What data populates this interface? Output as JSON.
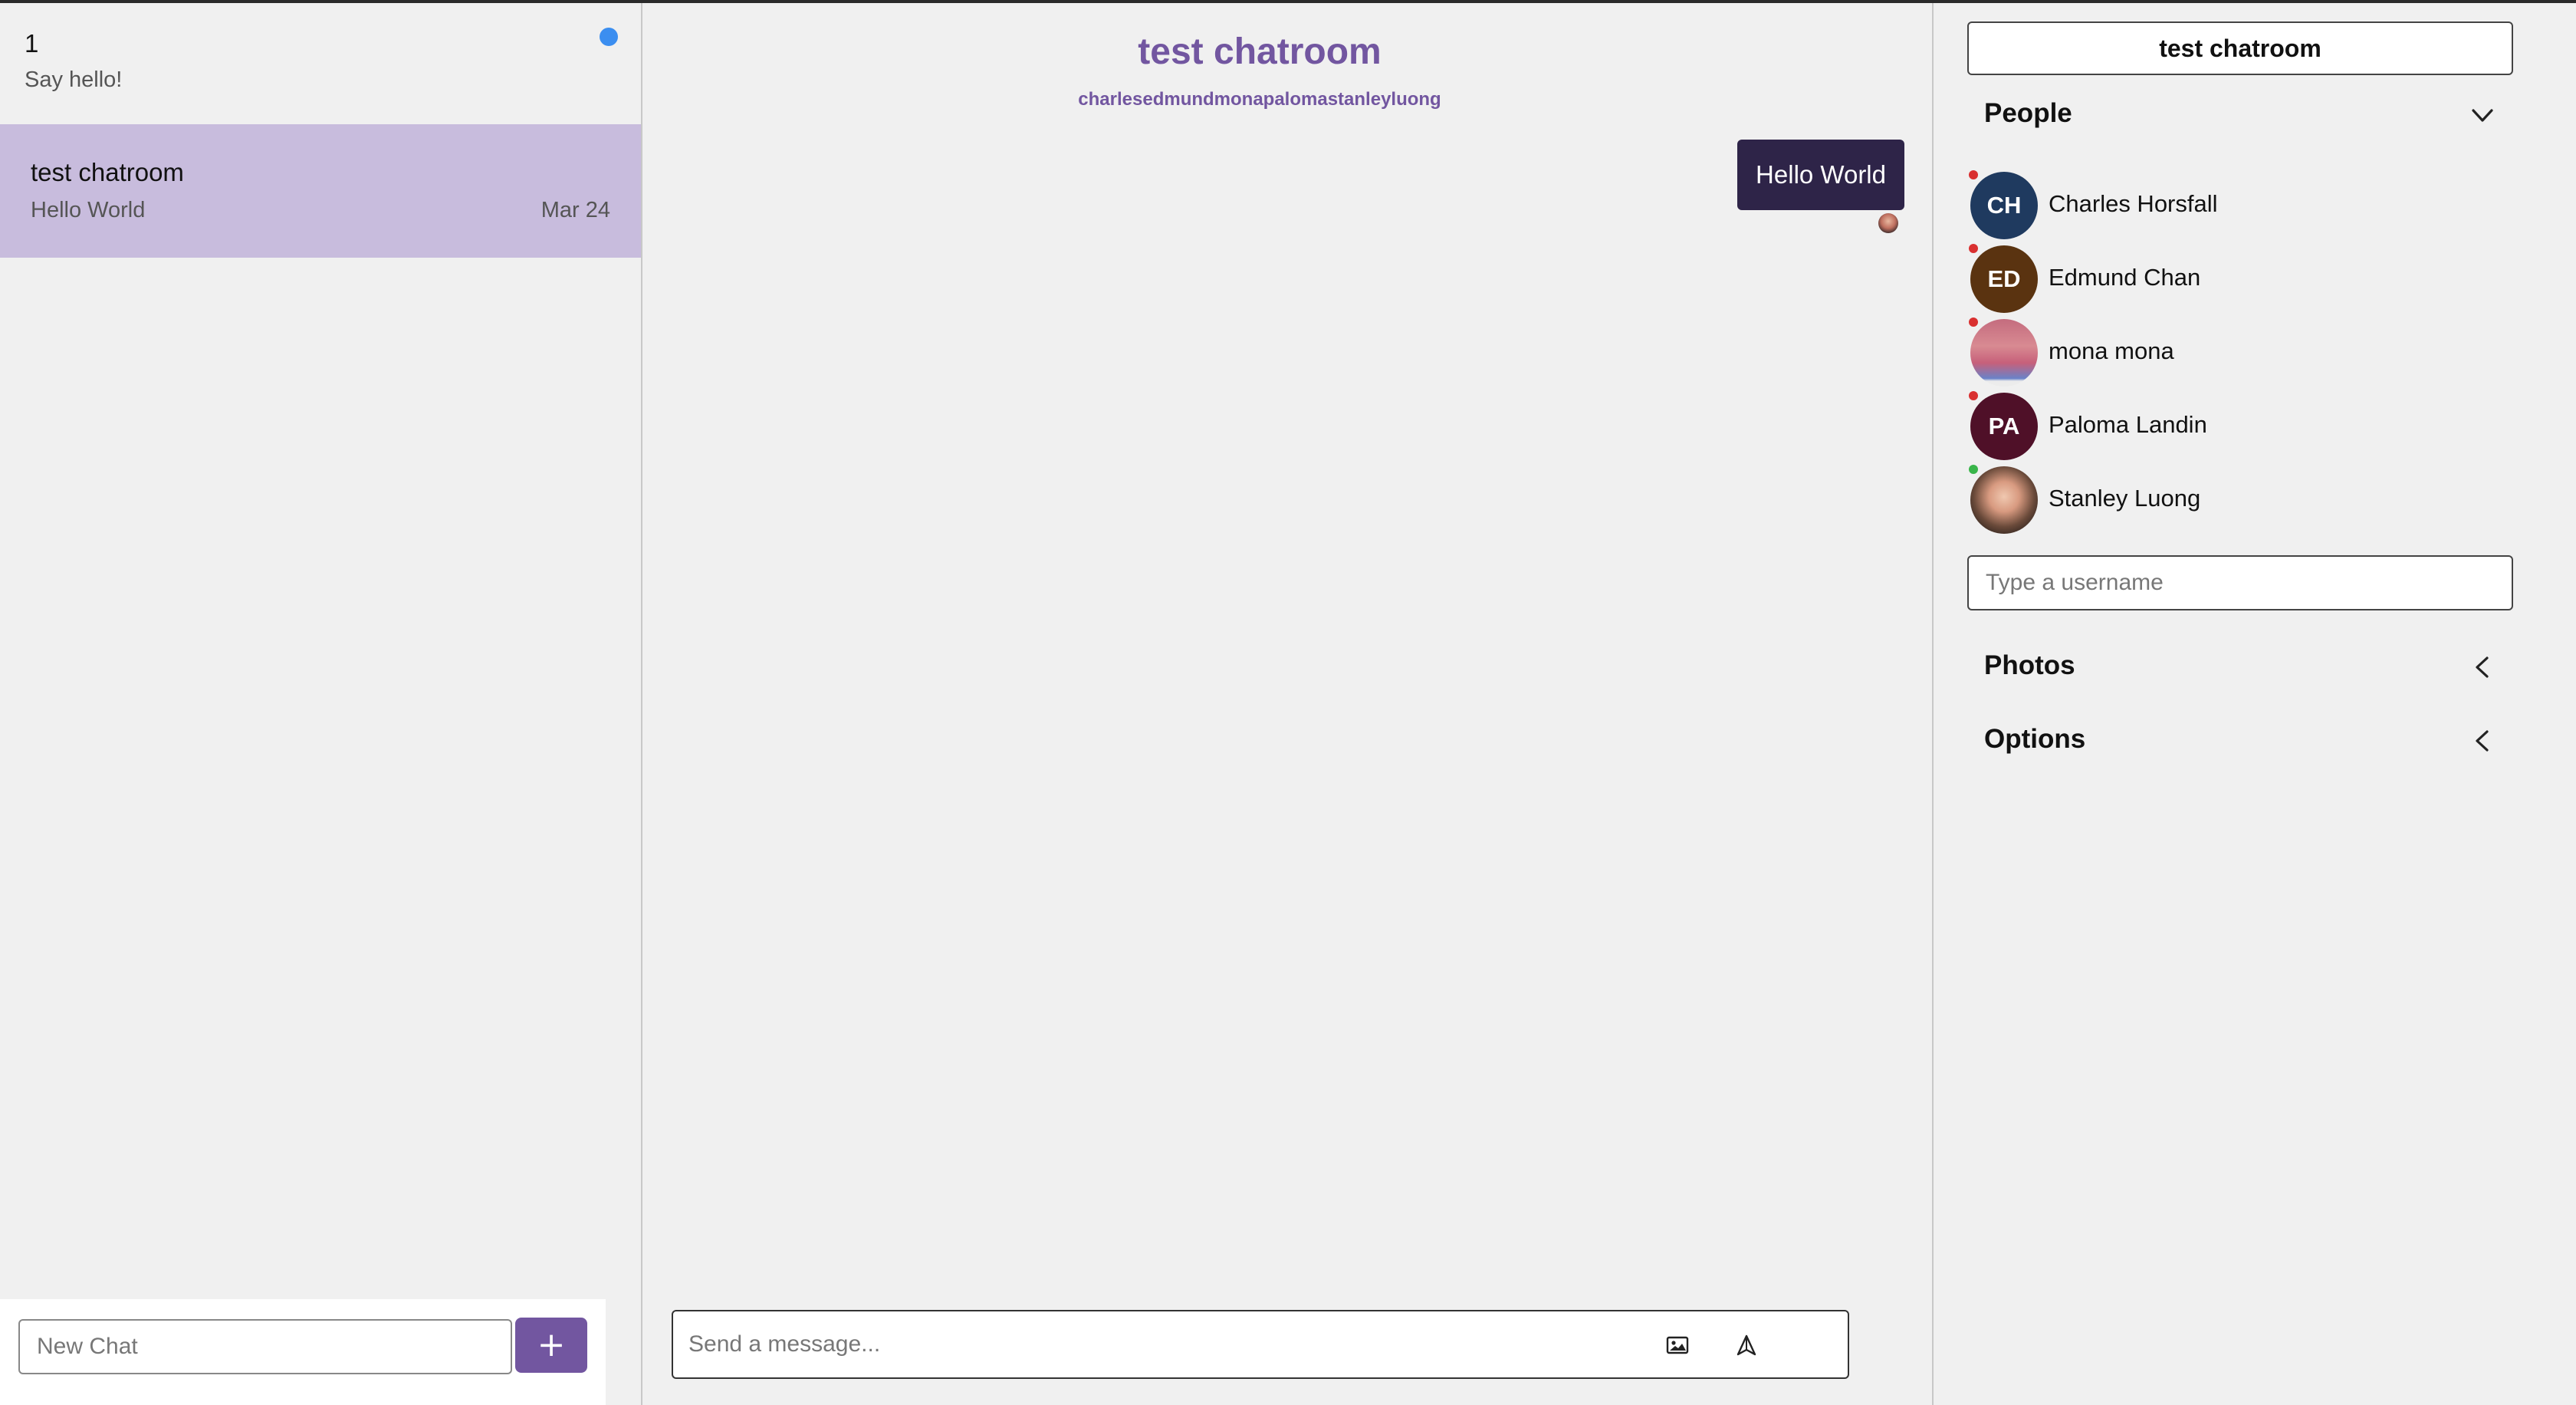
{
  "sidebar": {
    "chats": [
      {
        "title": "1",
        "preview": "Say hello!",
        "date": "",
        "unread": true,
        "active": false
      },
      {
        "title": "test chatroom",
        "preview": "Hello World",
        "date": "Mar 24",
        "unread": false,
        "active": true
      }
    ],
    "new_chat_placeholder": "New Chat",
    "add_label": "+"
  },
  "chat": {
    "title": "test chatroom",
    "members": "charlesedmundmonapalomastanleyluong",
    "messages": [
      {
        "text": "Hello World",
        "own": true
      }
    ],
    "composer_placeholder": "Send a message...",
    "image_icon": "image-icon",
    "send_icon": "send-icon"
  },
  "settings": {
    "room_name": "test chatroom",
    "people_label": "People",
    "people": [
      {
        "name": "Charles Horsfall",
        "initials": "CH",
        "color": "#1f3a5f",
        "online": false
      },
      {
        "name": "Edmund Chan",
        "initials": "ED",
        "color": "#5a3310",
        "online": false
      },
      {
        "name": "mona mona",
        "initials": "",
        "color": "#c77a86",
        "online": false
      },
      {
        "name": "Paloma Landin",
        "initials": "PA",
        "color": "#4f1028",
        "online": false
      },
      {
        "name": "Stanley Luong",
        "initials": "",
        "color": "#3a2c28",
        "online": true
      }
    ],
    "username_placeholder": "Type a username",
    "photos_label": "Photos",
    "options_label": "Options"
  },
  "colors": {
    "accent": "#7256a0",
    "active_chat": "#c8bcdd",
    "bubble": "#2e2448",
    "unread": "#3b8ef0",
    "offline": "#d93030",
    "online": "#39b54a"
  }
}
